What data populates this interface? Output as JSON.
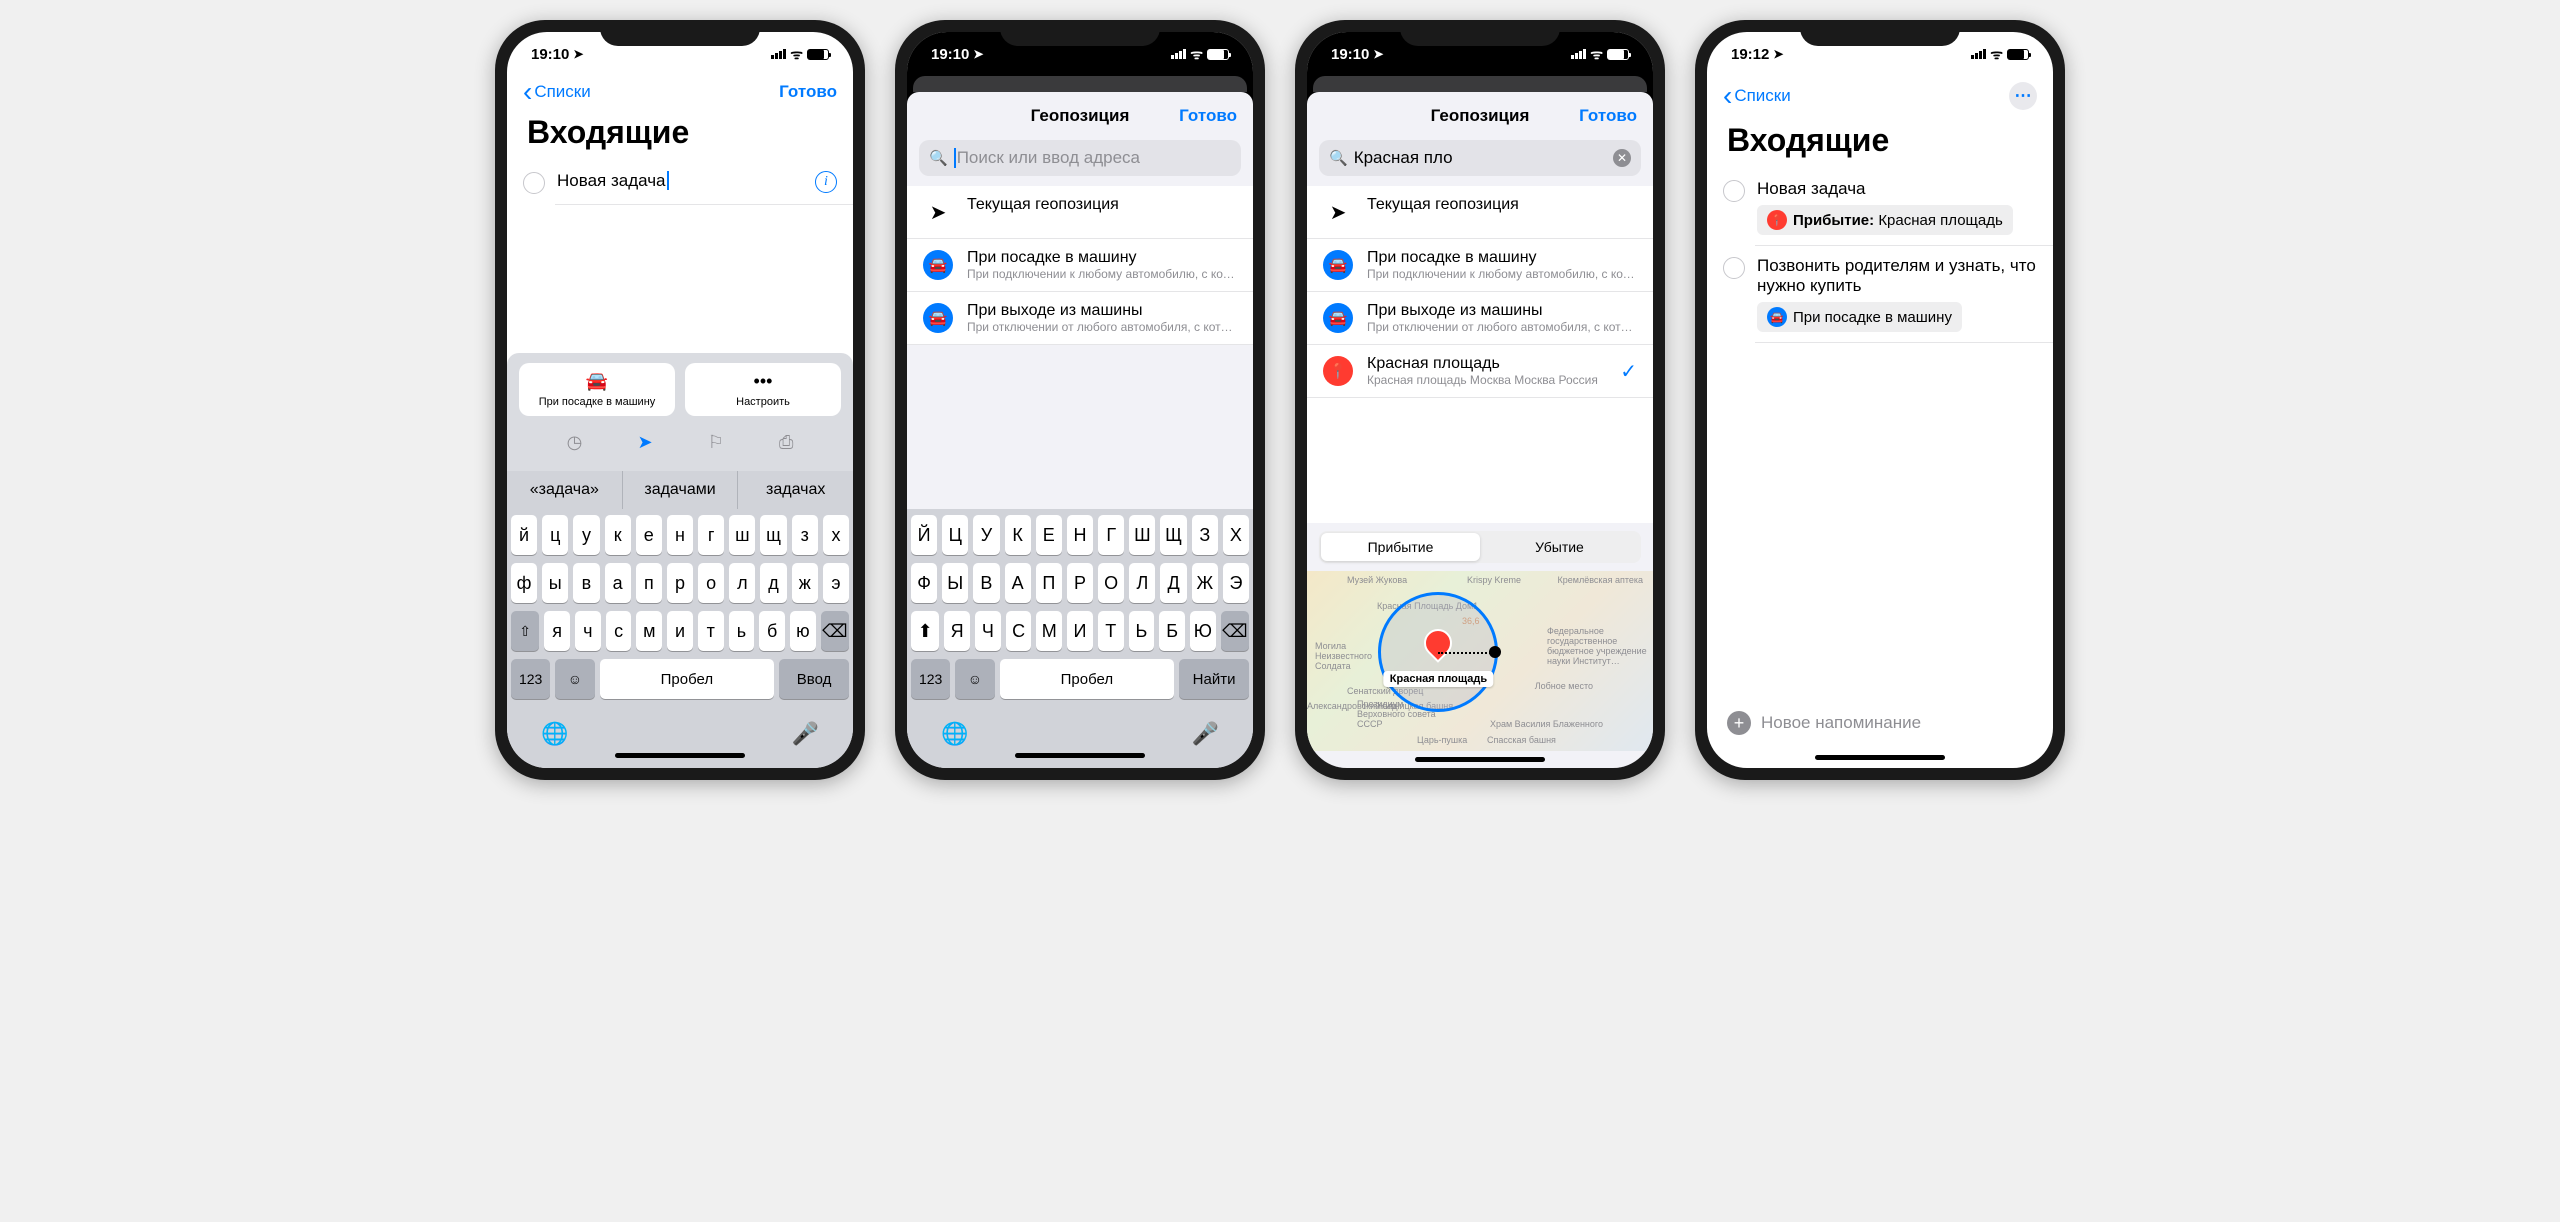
{
  "status": {
    "time1": "19:10",
    "time4": "19:12"
  },
  "nav": {
    "back": "Списки",
    "done": "Готово"
  },
  "screen1": {
    "title": "Входящие",
    "task": "Новая задача",
    "card1": "При посадке в машину",
    "card2": "Настроить",
    "qt1": "«задача»",
    "qt2": "задачами",
    "qt3": "задачах"
  },
  "screen2": {
    "title": "Геопозиция",
    "placeholder": "Поиск или ввод адреса",
    "opt1": "Текущая геопозиция",
    "opt2": "При посадке в машину",
    "opt2sub": "При подключении к любому автомобилю, с котор…",
    "opt3": "При выходе из машины",
    "opt3sub": "При отключении от любого автомобиля, с которы…"
  },
  "screen3": {
    "title": "Геопозиция",
    "search": "Красная пло",
    "opt4": "Красная площадь",
    "opt4sub": "Красная площадь Москва Москва Россия",
    "seg1": "Прибытие",
    "seg2": "Убытие",
    "pin_label": "Красная площадь",
    "map_labels": [
      "Музей Жукова",
      "Krispy Kreme",
      "Кремлёвская аптека",
      "Красная Площадь Дом1",
      "36,6",
      "Могила Неизвестного Солдата",
      "Федеральное государственное бюджетное учреждение науки Институт…",
      "Сенатский дворец",
      "Лобное место",
      "Житницкая башня",
      "Президиум Верховного совета СССР",
      "Храм Василия Блаженного",
      "Царь-пушка",
      "Спасская башня",
      "Александровский сад"
    ]
  },
  "screen4": {
    "title": "Входящие",
    "task1": "Новая задача",
    "tag1_label": "Прибытие:",
    "tag1_value": " Красная площадь",
    "task2": "Позвонить родителям и узнать, что нужно купить",
    "tag2": "При посадке в машину",
    "new": "Новое напоминание"
  },
  "kb": {
    "row1": [
      "й",
      "ц",
      "у",
      "к",
      "е",
      "н",
      "г",
      "ш",
      "щ",
      "з",
      "х"
    ],
    "row2": [
      "ф",
      "ы",
      "в",
      "а",
      "п",
      "р",
      "о",
      "л",
      "д",
      "ж",
      "э"
    ],
    "row3": [
      "я",
      "ч",
      "с",
      "м",
      "и",
      "т",
      "ь",
      "б",
      "ю"
    ],
    "row1_caps": [
      "Й",
      "Ц",
      "У",
      "К",
      "Е",
      "Н",
      "Г",
      "Ш",
      "Щ",
      "З",
      "Х"
    ],
    "row2_caps": [
      "Ф",
      "Ы",
      "В",
      "А",
      "П",
      "Р",
      "О",
      "Л",
      "Д",
      "Ж",
      "Э"
    ],
    "row3_caps": [
      "Я",
      "Ч",
      "С",
      "М",
      "И",
      "Т",
      "Ь",
      "Б",
      "Ю"
    ],
    "num": "123",
    "space": "Пробел",
    "enter": "Ввод",
    "find": "Найти"
  }
}
